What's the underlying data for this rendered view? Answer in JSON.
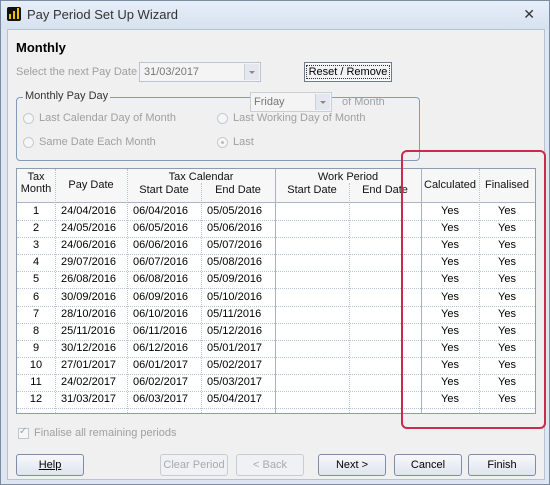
{
  "window": {
    "title": "Pay Period Set Up Wizard",
    "close_glyph": "✕"
  },
  "heading": "Monthly",
  "next_pay_date": {
    "label": "Select the next Pay Date",
    "value": "31/03/2017"
  },
  "reset_button": "Reset / Remove",
  "monthly_pay_day": {
    "legend": "Monthly Pay Day",
    "options": {
      "last_calendar_day": "Last Calendar Day of Month",
      "last_working_day": "Last Working Day of Month",
      "same_date": "Same Date Each Month",
      "last": "Last"
    },
    "day_value": "Friday",
    "of_month": "of Month"
  },
  "table": {
    "headers": {
      "tax_month": "Tax\nMonth",
      "pay_date": "Pay Date",
      "tax_calendar": "Tax Calendar",
      "start_date": "Start Date",
      "end_date": "End Date",
      "work_period": "Work Period",
      "work_start": "Start Date",
      "work_end": "End Date",
      "calculated": "Calculated",
      "finalised": "Finalised"
    },
    "rows": [
      {
        "month": "1",
        "pay": "24/04/2016",
        "start": "06/04/2016",
        "end": "05/05/2016",
        "calc": "Yes",
        "fin": "Yes"
      },
      {
        "month": "2",
        "pay": "24/05/2016",
        "start": "06/05/2016",
        "end": "05/06/2016",
        "calc": "Yes",
        "fin": "Yes"
      },
      {
        "month": "3",
        "pay": "24/06/2016",
        "start": "06/06/2016",
        "end": "05/07/2016",
        "calc": "Yes",
        "fin": "Yes"
      },
      {
        "month": "4",
        "pay": "29/07/2016",
        "start": "06/07/2016",
        "end": "05/08/2016",
        "calc": "Yes",
        "fin": "Yes"
      },
      {
        "month": "5",
        "pay": "26/08/2016",
        "start": "06/08/2016",
        "end": "05/09/2016",
        "calc": "Yes",
        "fin": "Yes"
      },
      {
        "month": "6",
        "pay": "30/09/2016",
        "start": "06/09/2016",
        "end": "05/10/2016",
        "calc": "Yes",
        "fin": "Yes"
      },
      {
        "month": "7",
        "pay": "28/10/2016",
        "start": "06/10/2016",
        "end": "05/11/2016",
        "calc": "Yes",
        "fin": "Yes"
      },
      {
        "month": "8",
        "pay": "25/11/2016",
        "start": "06/11/2016",
        "end": "05/12/2016",
        "calc": "Yes",
        "fin": "Yes"
      },
      {
        "month": "9",
        "pay": "30/12/2016",
        "start": "06/12/2016",
        "end": "05/01/2017",
        "calc": "Yes",
        "fin": "Yes"
      },
      {
        "month": "10",
        "pay": "27/01/2017",
        "start": "06/01/2017",
        "end": "05/02/2017",
        "calc": "Yes",
        "fin": "Yes"
      },
      {
        "month": "11",
        "pay": "24/02/2017",
        "start": "06/02/2017",
        "end": "05/03/2017",
        "calc": "Yes",
        "fin": "Yes"
      },
      {
        "month": "12",
        "pay": "31/03/2017",
        "start": "06/03/2017",
        "end": "05/04/2017",
        "calc": "Yes",
        "fin": "Yes"
      }
    ]
  },
  "finalise_remaining": "Finalise all remaining periods",
  "buttons": {
    "help": "Help",
    "clear_period": "Clear Period",
    "back": "< Back",
    "next": "Next >",
    "cancel": "Cancel",
    "finish": "Finish"
  },
  "colors": {
    "highlight": "#c72b4e",
    "title_bg": "#dde6f1"
  }
}
